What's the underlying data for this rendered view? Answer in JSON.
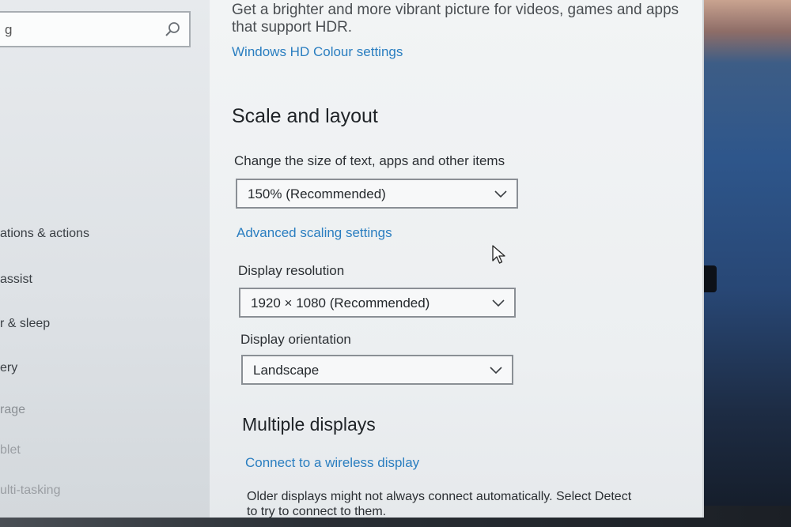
{
  "sidebar": {
    "search": {
      "value": "g"
    },
    "items": [
      {
        "label": "ations & actions"
      },
      {
        "label": "assist"
      },
      {
        "label": "r & sleep"
      },
      {
        "label": "ery"
      },
      {
        "label": "rage"
      },
      {
        "label": "blet"
      },
      {
        "label": "ulti-tasking"
      }
    ]
  },
  "main": {
    "hdr_description_line1": "Get a brighter and more vibrant picture for videos, games and apps",
    "hdr_description_line2": "that support HDR.",
    "hdr_link": "Windows HD Colour settings",
    "scale_heading": "Scale and layout",
    "scale_label": "Change the size of text, apps and other items",
    "scale_value": "150% (Recommended)",
    "advanced_scaling_link": "Advanced scaling settings",
    "resolution_label": "Display resolution",
    "resolution_value": "1920 × 1080 (Recommended)",
    "orientation_label": "Display orientation",
    "orientation_value": "Landscape",
    "multiple_heading": "Multiple displays",
    "wireless_link": "Connect to a wireless display",
    "older_note_line1": "Older displays might not always connect automatically. Select Detect",
    "older_note_line2": "to try to connect to them."
  },
  "icons": {
    "search": "search-icon",
    "chevron": "chevron-down-icon",
    "cursor": "mouse-cursor-icon"
  },
  "colors": {
    "link": "#2a7ec0",
    "background": "#eef1f3"
  }
}
